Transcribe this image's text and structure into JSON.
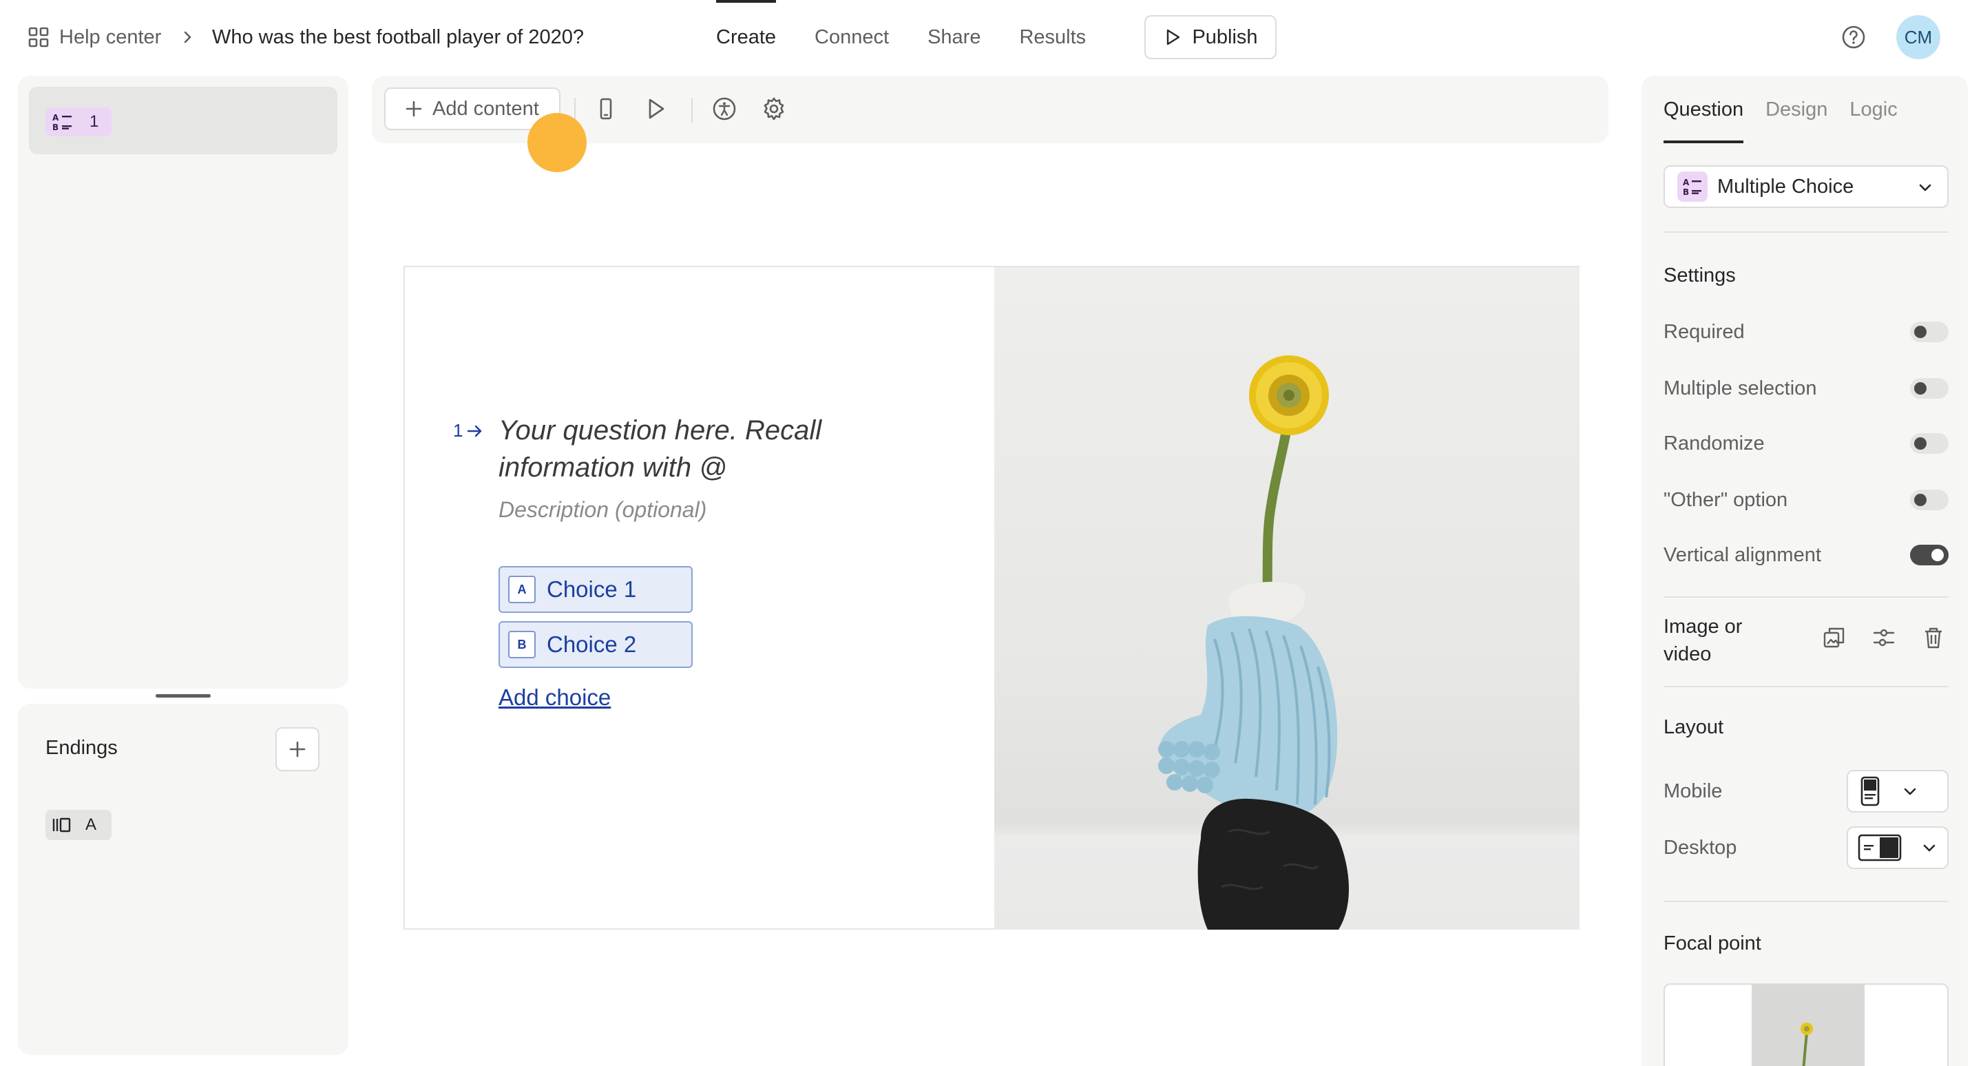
{
  "breadcrumb": {
    "home_label": "Help center",
    "form_title": "Who was the best football player of 2020?"
  },
  "nav": {
    "tabs": [
      {
        "label": "Create",
        "active": true
      },
      {
        "label": "Connect",
        "active": false
      },
      {
        "label": "Share",
        "active": false
      },
      {
        "label": "Results",
        "active": false
      }
    ],
    "publish_label": "Publish"
  },
  "user": {
    "initials": "CM",
    "avatar_color": "#bde3f6"
  },
  "questions_list": {
    "items": [
      {
        "number": "1",
        "type_icon": "multiple-choice-icon",
        "badge_color": "#ecd6f5"
      }
    ]
  },
  "endings": {
    "label": "Endings",
    "items": [
      {
        "letter": "A",
        "icon": "ending-icon"
      }
    ]
  },
  "toolbar": {
    "add_content_label": "Add content",
    "icons": [
      "mobile-preview-icon",
      "play-preview-icon",
      "accessibility-icon",
      "settings-gear-icon"
    ]
  },
  "question": {
    "number": "1",
    "text": "Your question here. Recall information with @",
    "description": "Description (optional)",
    "choices": [
      {
        "key": "A",
        "label": "Choice 1"
      },
      {
        "key": "B",
        "label": "Choice 2"
      }
    ],
    "add_choice_label": "Add choice",
    "accent_color": "#1c3f9f"
  },
  "right_panel": {
    "tabs": [
      {
        "label": "Question",
        "active": true
      },
      {
        "label": "Design",
        "active": false
      },
      {
        "label": "Logic",
        "active": false
      }
    ],
    "question_type": "Multiple Choice",
    "settings_title": "Settings",
    "settings": [
      {
        "label": "Required",
        "on": false
      },
      {
        "label": "Multiple selection",
        "on": false
      },
      {
        "label": "Randomize",
        "on": false
      },
      {
        "label": "\"Other\" option",
        "on": false
      },
      {
        "label": "Vertical alignment",
        "on": true
      }
    ],
    "image_or_video_label": "Image or video",
    "layout_title": "Layout",
    "layout": [
      {
        "label": "Mobile",
        "icon": "mobile-layout-icon"
      },
      {
        "label": "Desktop",
        "icon": "desktop-layout-icon"
      }
    ],
    "focal_point_title": "Focal point"
  }
}
